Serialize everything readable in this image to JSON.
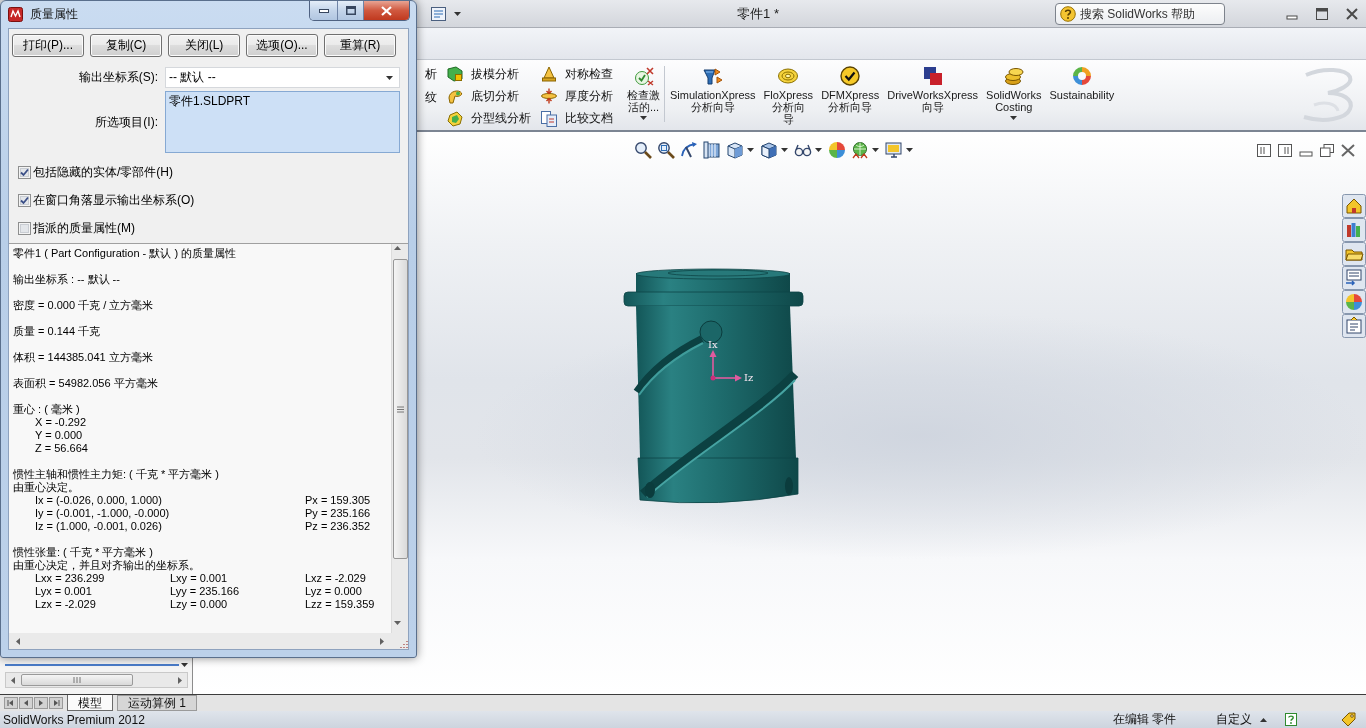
{
  "mass_properties_dialog": {
    "title": "质量属性",
    "buttons": [
      "打印(P)...",
      "复制(C)",
      "关闭(L)",
      "选项(O)...",
      "重算(R)"
    ],
    "output_coordinate_system": {
      "label": "输出坐标系(S):",
      "value": "-- 默认 --"
    },
    "selected_items": {
      "label": "所选项目(I):",
      "items": [
        "零件1.SLDPRT"
      ]
    },
    "options": [
      {
        "label": "包括隐藏的实体/零部件(H)",
        "checked": true
      },
      {
        "label": "在窗口角落显示输出坐标系(O)",
        "checked": true
      },
      {
        "label": "指派的质量属性(M)",
        "checked": false
      }
    ],
    "report": [
      {
        "lines": [
          "零件1 ( Part Configuration - 默认 ) 的质量属性"
        ]
      },
      {
        "lines": [
          "输出坐标系 : -- 默认 --"
        ]
      },
      {
        "lines": [
          "密度 = 0.000 千克 / 立方毫米"
        ]
      },
      {
        "lines": [
          "质量 = 0.144 千克"
        ]
      },
      {
        "lines": [
          "体积 = 144385.041 立方毫米"
        ]
      },
      {
        "lines": [
          "表面积 = 54982.056 平方毫米"
        ]
      },
      {
        "lines": [
          "重心 : ( 毫米 )"
        ],
        "rows": [
          [
            "X = -0.292"
          ],
          [
            "Y = 0.000"
          ],
          [
            "Z = 56.664"
          ]
        ]
      },
      {
        "lines": [
          "惯性主轴和惯性主力矩: ( 千克 * 平方毫米 )",
          "由重心决定。"
        ],
        "rows": [
          [
            "Ix = (-0.026, 0.000, 1.000)",
            "Px = 159.305"
          ],
          [
            "Iy = (-0.001, -1.000, -0.000)",
            "Py = 235.166"
          ],
          [
            "Iz = (1.000, -0.001, 0.026)",
            "Pz = 236.352"
          ]
        ]
      },
      {
        "lines": [
          "惯性张量: ( 千克 * 平方毫米 )",
          "由重心决定，并且对齐输出的坐标系。"
        ],
        "rows": [
          [
            "Lxx = 236.299",
            "Lxy = 0.001",
            "Lxz = -2.029"
          ],
          [
            "Lyx = 0.001",
            "Lyy = 235.166",
            "Lyz = 0.000"
          ],
          [
            "Lzx = -2.029",
            "Lzy = 0.000",
            "Lzz = 159.359"
          ]
        ]
      }
    ]
  },
  "main_window": {
    "title": "零件1 *",
    "search": {
      "placeholder": "搜索 SolidWorks 帮助"
    }
  },
  "ribbon": {
    "cut_off_labels": [
      "析",
      "纹"
    ],
    "tool_columns": [
      [
        "拔模分析",
        "底切分析",
        "分型线分析"
      ],
      [
        "对称检查",
        "厚度分析",
        "比较文档"
      ]
    ],
    "large_tool_groups": [
      [
        {
          "lines": [
            "检查激",
            "活的..."
          ],
          "dropdown": true
        }
      ],
      [
        {
          "lines": [
            "SimulationXpress",
            "分析向导"
          ],
          "dropdown": false
        },
        {
          "lines": [
            "FloXpress",
            "分析向",
            "导"
          ],
          "dropdown": false
        },
        {
          "lines": [
            "DFMXpress",
            "分析向导"
          ],
          "dropdown": false
        },
        {
          "lines": [
            "DriveWorksXpress",
            "向导"
          ],
          "dropdown": false
        },
        {
          "lines": [
            "SolidWorks",
            "Costing"
          ],
          "dropdown": true
        },
        {
          "lines": [
            "Sustainability"
          ],
          "dropdown": false
        }
      ]
    ]
  },
  "graphics_area": {
    "triad_labels": [
      "Ix",
      "Iz"
    ]
  },
  "document_tabs": [
    {
      "label": "模型",
      "selected": true
    },
    {
      "label": "运动算例 1",
      "selected": false
    }
  ],
  "status_bar": {
    "product": "SolidWorks Premium 2012",
    "mode": "在编辑 零件",
    "units": "自定义"
  }
}
